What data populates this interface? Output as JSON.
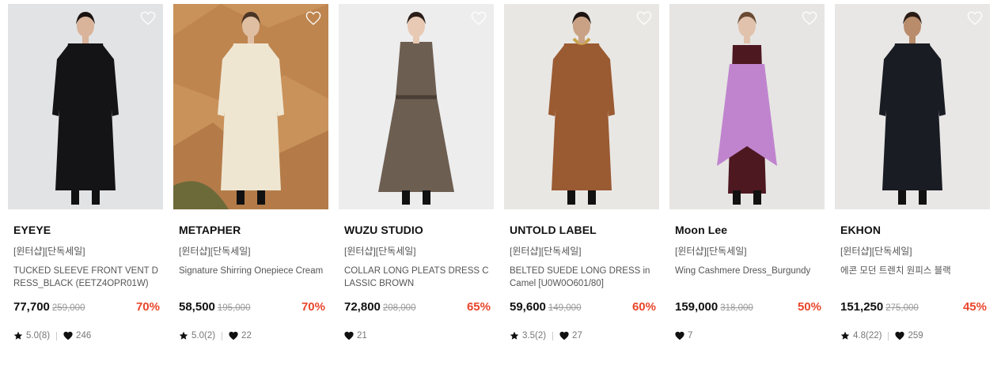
{
  "colors": {
    "accent": "#e8462b",
    "text": "#111111",
    "muted": "#555555"
  },
  "products": [
    {
      "brand": "EYEYE",
      "tag": "[윈터샵][단독세일]",
      "name": "TUCKED SLEEVE FRONT VENT DRESS_BLACK (EETZ4OPR01W)",
      "price": "77,700",
      "original_price": "259,000",
      "discount": "70%",
      "rating": "5.0(8)",
      "likes": "246",
      "photo": {
        "bg": "#e2e3e5",
        "dress": "#141416",
        "skin": "#d9b39a",
        "hair": "#1a1210",
        "accent": "#141416"
      }
    },
    {
      "brand": "METAPHER",
      "tag": "[윈터샵][단독세일]",
      "name": "Signature Shirring Onepiece Cream",
      "price": "58,500",
      "original_price": "195,000",
      "discount": "70%",
      "rating": "5.0(2)",
      "likes": "22",
      "photo": {
        "bg": "#c9925a",
        "dress": "#efe6d2",
        "skin": "#e0bea2",
        "hair": "#4a3526",
        "accent": "#a87444"
      }
    },
    {
      "brand": "WUZU STUDIO",
      "tag": "[윈터샵][단독세일]",
      "name": "COLLAR LONG PLEATS DRESS CLASSIC BROWN",
      "price": "72,800",
      "original_price": "208,000",
      "discount": "65%",
      "rating": "",
      "likes": "21",
      "photo": {
        "bg": "#ededed",
        "dress": "#6d5e52",
        "skin": "#e7c9b4",
        "hair": "#2b1e18",
        "accent": "#5a4c42"
      }
    },
    {
      "brand": "UNTOLD LABEL",
      "tag": "[윈터샵][단독세일]",
      "name": "BELTED SUEDE LONG DRESS in Camel [U0W0O601/80]",
      "price": "59,600",
      "original_price": "149,000",
      "discount": "60%",
      "rating": "3.5(2)",
      "likes": "27",
      "photo": {
        "bg": "#e9e7e4",
        "dress": "#9a5a32",
        "skin": "#c9a184",
        "hair": "#1c1411",
        "accent": "#c8a24a"
      }
    },
    {
      "brand": "Moon Lee",
      "tag": "[윈터샵][단독세일]",
      "name": "Wing Cashmere Dress_Burgundy",
      "price": "159,000",
      "original_price": "318,000",
      "discount": "50%",
      "rating": "",
      "likes": "7",
      "photo": {
        "bg": "#e6e5e3",
        "dress": "#4e1821",
        "skin": "#e0c2ad",
        "hair": "#6b4a33",
        "accent": "#c084cf"
      }
    },
    {
      "brand": "EKHON",
      "tag": "[윈터샵][단독세일]",
      "name": "에콘 모던 트렌치 원피스 블랙",
      "price": "151,250",
      "original_price": "275,000",
      "discount": "45%",
      "rating": "4.8(22)",
      "likes": "259",
      "photo": {
        "bg": "#e8e7e5",
        "dress": "#1a1c24",
        "skin": "#b98c6c",
        "hair": "#2a1c14",
        "accent": "#1a1c24"
      }
    }
  ]
}
